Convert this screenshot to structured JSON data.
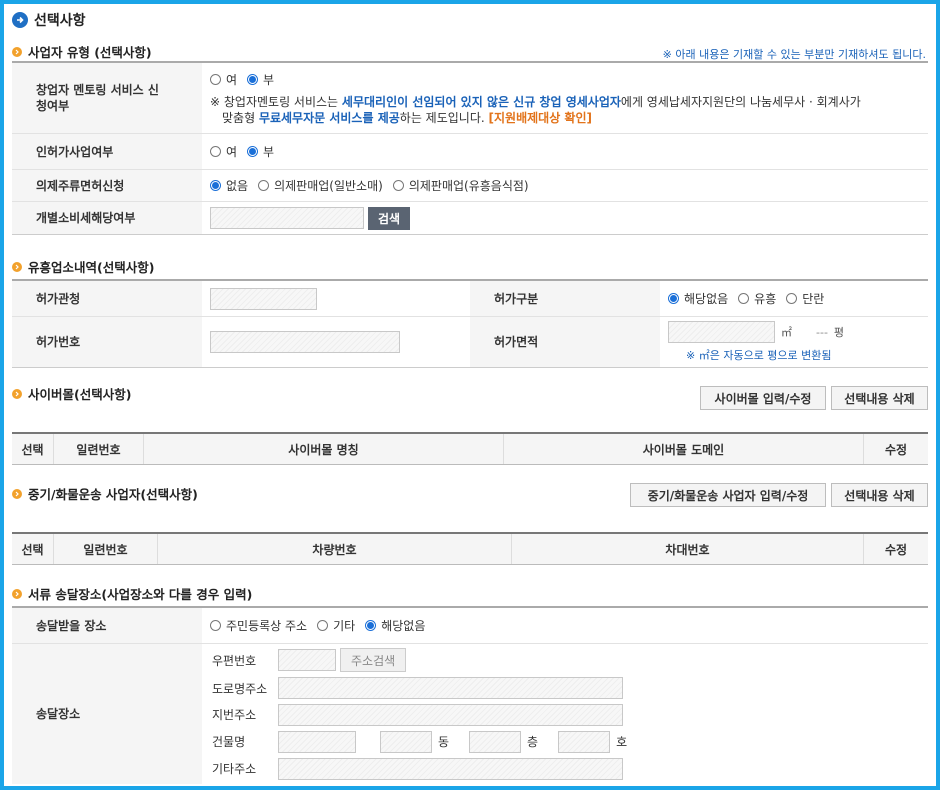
{
  "page": {
    "title": "선택사항"
  },
  "business_type": {
    "title": "사업자 유형 (선택사항)",
    "note": "※ 아래 내용은 기재할 수 있는 부분만 기재하셔도 됩니다.",
    "mentoring": {
      "label": "창업자 멘토링 서비스 신청여부",
      "options": [
        "여",
        "부"
      ],
      "selected": "부",
      "desc_prefix": "※ 창업자멘토링 서비스는 ",
      "desc_bold1": "세무대리인이 선임되어 있지 않은 신규 창업 영세사업자",
      "desc_mid1": "에게 영세납세자지원단의 나눔세무사 · 회계사가",
      "desc_line2_prefix": "맞춤형 ",
      "desc_bold2": "무료세무자문 서비스를 제공",
      "desc_mid2": "하는 제도입니다. ",
      "desc_link": "[지원배제대상 확인]"
    },
    "license": {
      "label": "인허가사업여부",
      "options": [
        "여",
        "부"
      ],
      "selected": "부"
    },
    "liquor": {
      "label": "의제주류면허신청",
      "options": [
        "없음",
        "의제판매업(일반소매)",
        "의제판매업(유흥음식점)"
      ],
      "selected": "없음"
    },
    "excise": {
      "label": "개별소비세해당여부",
      "search_button": "검색"
    }
  },
  "entertainment": {
    "title": "유흥업소내역(선택사항)",
    "authority_label": "허가관청",
    "category_label": "허가구분",
    "category_options": [
      "해당없음",
      "유흥",
      "단란"
    ],
    "category_selected": "해당없음",
    "number_label": "허가번호",
    "area_label": "허가면적",
    "area_unit": "㎡",
    "pyeong_value": "---",
    "pyeong_unit": "평",
    "area_note": "※ ㎡은 자동으로 평으로 변환됨"
  },
  "cybermall": {
    "title": "사이버몰(선택사항)",
    "btn_input": "사이버몰 입력/수정",
    "btn_delete": "선택내용 삭제",
    "columns": [
      "선택",
      "일련번호",
      "사이버몰 명칭",
      "사이버몰 도메인",
      "수정"
    ]
  },
  "freight": {
    "title": "중기/화물운송 사업자(선택사항)",
    "btn_input": "중기/화물운송 사업자 입력/수정",
    "btn_delete": "선택내용 삭제",
    "columns": [
      "선택",
      "일련번호",
      "차량번호",
      "차대번호",
      "수정"
    ]
  },
  "delivery": {
    "title": "서류 송달장소(사업장소와 다를 경우 입력)",
    "place_label": "송달받을 장소",
    "place_options": [
      "주민등록상 주소",
      "기타",
      "해당없음"
    ],
    "place_selected": "해당없음",
    "address_label": "송달장소",
    "zipcode_label": "우편번호",
    "address_search_button": "주소검색",
    "road_label": "도로명주소",
    "lot_label": "지번주소",
    "building_label": "건물명",
    "dong_unit": "동",
    "floor_unit": "층",
    "ho_unit": "호",
    "other_label": "기타주소"
  },
  "colors": {
    "frame": "#1aa5e8",
    "accent_blue": "#1a62b8",
    "accent_orange": "#e2731a",
    "section_dot": "#f2a12c",
    "radio_on": "#1a6fd8"
  }
}
